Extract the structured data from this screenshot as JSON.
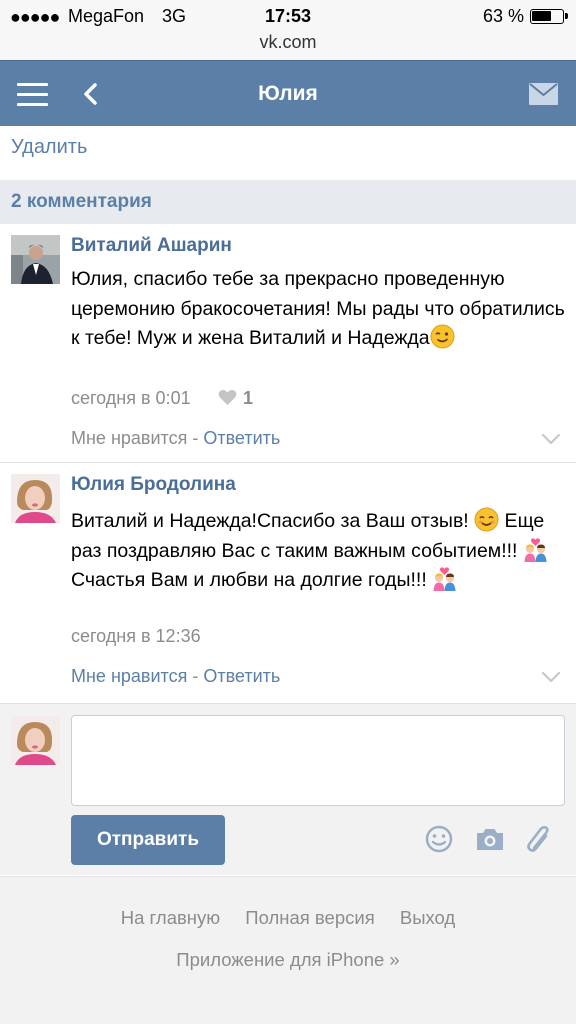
{
  "status_bar": {
    "signal": "●●●●●",
    "carrier": "MegaFon",
    "network": "3G",
    "time": "17:53",
    "battery": "63 %",
    "url": "vk.com"
  },
  "nav": {
    "title": "Юлия"
  },
  "delete_label": "Удалить",
  "comments_header": "2 комментария",
  "comments": [
    {
      "author": "Виталий Ашарин",
      "text": "Юлия, спасибо тебе за прекрасно проведенную церемонию бракосочетания! Мы рады что обратились к тебе! Муж и жена Виталий и Надежда",
      "emoji": "winking-face",
      "time": "сегодня в 0:01",
      "likes": "1",
      "like_label": "Мне нравится",
      "separator": " - ",
      "reply_label": "Ответить"
    },
    {
      "author": "Юлия Бродолина",
      "text_part1": "Виталий и Надежда!Спасибо за Ваш отзыв! ",
      "text_part2": " Еще раз поздравляю Вас с таким важным событием!!! ",
      "text_part3": " Счастья Вам и любви на долгие годы!!! ",
      "time": "сегодня в 12:36",
      "like_label": "Мне нравится",
      "separator": " - ",
      "reply_label": "Ответить"
    }
  ],
  "composer": {
    "send_label": "Отправить",
    "input_value": ""
  },
  "footer": {
    "links": [
      "На главную",
      "Полная версия",
      "Выход"
    ],
    "app_link": "Приложение для iPhone »"
  },
  "colors": {
    "accent": "#5b7fa6",
    "nav_bg": "#5b7fa6",
    "section_bg": "#e7ebf0"
  }
}
